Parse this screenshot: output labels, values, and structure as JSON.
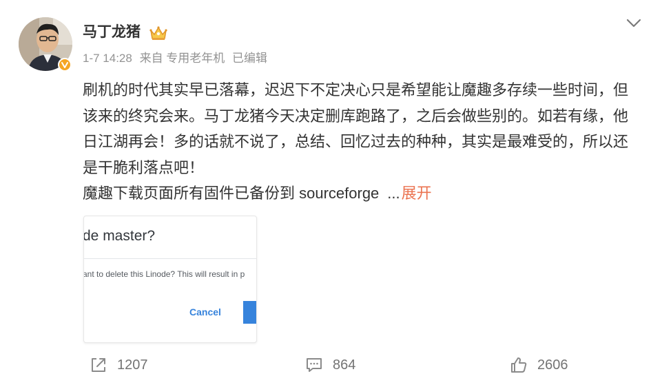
{
  "user": {
    "name": "马丁龙猪",
    "avatar_icon": "user-avatar-photo",
    "verified_badge_icon": "verified-v-icon",
    "vip_icon": "crown-icon"
  },
  "meta": {
    "time": "1-7 14:28",
    "source": "来自 专用老年机",
    "edited": "已编辑"
  },
  "post": {
    "text": "刷机的时代其实早已落幕，迟迟下不定决心只是希望能让魔趣多存续一些时间，但该来的终究会来。马丁龙猪今天决定删库跑路了，之后会做些别的。如若有缘，他日江湖再会！多的话就不说了，总结、回忆过去的种种，其实是最难受的，所以还是干脆利落点吧！",
    "line2": "魔趣下载页面所有固件已备份到 sourceforge",
    "ellipsis": "...",
    "expand_label": "展开"
  },
  "image": {
    "dialog_title": "de master?",
    "dialog_text": "ant to delete this Linode? This will result in p",
    "cancel_label": "Cancel"
  },
  "actions": {
    "repost_count": "1207",
    "comment_count": "864",
    "like_count": "2606"
  },
  "colors": {
    "accent_link": "#eb7350",
    "meta_gray": "#939393",
    "linode_blue": "#3683dc",
    "verified_orange": "#f5a623"
  }
}
